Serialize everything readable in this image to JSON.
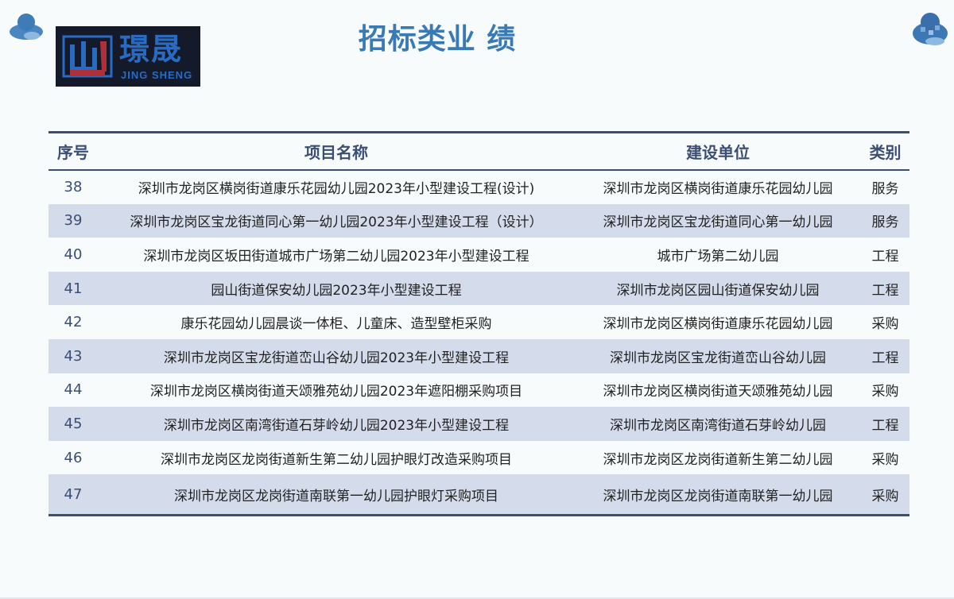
{
  "page": {
    "title": "招标类业 绩"
  },
  "logo": {
    "cn": "璟晟",
    "en": "JING SHENG"
  },
  "table": {
    "headers": {
      "num": "序号",
      "project": "项目名称",
      "unit": "建设单位",
      "type": "类别"
    },
    "rows": [
      {
        "num": "38",
        "project": "深圳市龙岗区横岗街道康乐花园幼儿园2023年小型建设工程(设计)",
        "unit": "深圳市龙岗区横岗街道康乐花园幼儿园",
        "type": "服务"
      },
      {
        "num": "39",
        "project": "深圳市龙岗区宝龙街道同心第一幼儿园2023年小型建设工程（设计）",
        "unit": "深圳市龙岗区宝龙街道同心第一幼儿园",
        "type": "服务"
      },
      {
        "num": "40",
        "project": "深圳市龙岗区坂田街道城市广场第二幼儿园2023年小型建设工程",
        "unit": "城市广场第二幼儿园",
        "type": "工程"
      },
      {
        "num": "41",
        "project": "园山街道保安幼儿园2023年小型建设工程",
        "unit": "深圳市龙岗区园山街道保安幼儿园",
        "type": "工程"
      },
      {
        "num": "42",
        "project": "康乐花园幼儿园晨谈一体柜、儿童床、造型壁柜采购",
        "unit": "深圳市龙岗区横岗街道康乐花园幼儿园",
        "type": "采购"
      },
      {
        "num": "43",
        "project": "深圳市龙岗区宝龙街道峦山谷幼儿园2023年小型建设工程",
        "unit": "深圳市龙岗区宝龙街道峦山谷幼儿园",
        "type": "工程"
      },
      {
        "num": "44",
        "project": "深圳市龙岗区横岗街道天颂雅苑幼儿园2023年遮阳棚采购项目",
        "unit": "深圳市龙岗区横岗街道天颂雅苑幼儿园",
        "type": "采购"
      },
      {
        "num": "45",
        "project": "深圳市龙岗区南湾街道石芽岭幼儿园2023年小型建设工程",
        "unit": "深圳市龙岗区南湾街道石芽岭幼儿园",
        "type": "工程"
      },
      {
        "num": "46",
        "project": "深圳市龙岗区龙岗街道新生第二幼儿园护眼灯改造采购项目",
        "unit": "深圳市龙岗区龙岗街道新生第二幼儿园",
        "type": "采购"
      },
      {
        "num": "47",
        "project": "深圳市龙岗区龙岗街道南联第一幼儿园护眼灯采购项目",
        "unit": "深圳市龙岗区龙岗街道南联第一幼儿园",
        "type": "采购"
      }
    ]
  },
  "colors": {
    "accent": "#3a7ab4",
    "header_text": "#3b4e74",
    "row_alt": "#d4dbeb",
    "logo_bg": "#141a2a",
    "logo_text": "#2a6bc2"
  },
  "icons": [
    "cloud-decoration-icon",
    "logo-mark-icon"
  ]
}
